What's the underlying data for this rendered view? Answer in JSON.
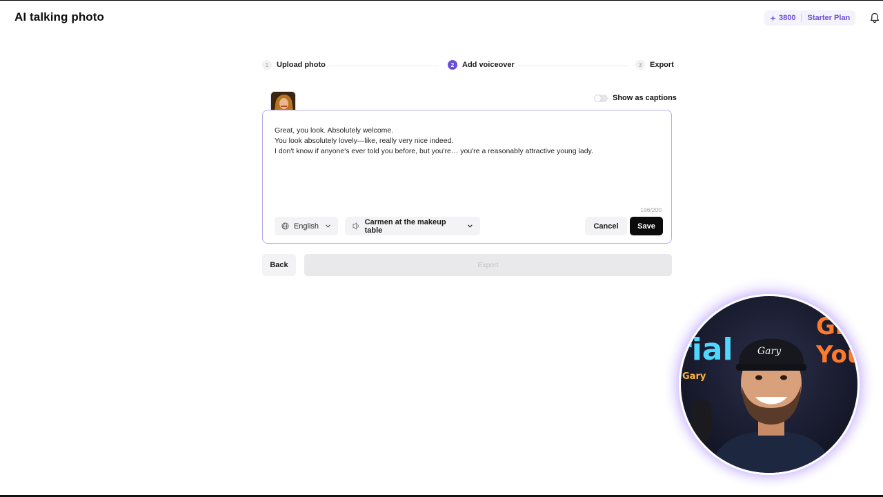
{
  "header": {
    "title": "AI talking photo",
    "credits": "3800",
    "plan": "Starter Plan"
  },
  "stepper": {
    "steps": [
      {
        "number": "1",
        "label": "Upload photo",
        "state": "done"
      },
      {
        "number": "2",
        "label": "Add voiceover",
        "state": "active"
      },
      {
        "number": "3",
        "label": "Export",
        "state": "pending"
      }
    ]
  },
  "captions": {
    "label": "Show as captions",
    "enabled": false
  },
  "editor": {
    "lines": [
      "Great, you look. Absolutely welcome.",
      "You look absolutely lovely—like, really very nice indeed.",
      "I don't know if anyone's ever told you before, but you're… you're a reasonably attractive young lady."
    ],
    "char_count": "196/200",
    "language": "English",
    "voice": "Carmen at the makeup table",
    "cancel_label": "Cancel",
    "save_label": "Save"
  },
  "footer": {
    "back_label": "Back",
    "export_label": "Export"
  },
  "webcam": {
    "cap_text": "Gary",
    "neon_left": "rial",
    "neon_small": "Gary",
    "neon_right_top": "Gr",
    "neon_right_bottom": "You"
  },
  "colors": {
    "accent": "#6b4fd8",
    "editor_border": "#b9a8ec",
    "save_bg": "#0b0b0b"
  },
  "icons": {
    "credits": "sparkle-icon",
    "notifications": "bell-icon",
    "language": "globe-icon",
    "voice": "voice-icon",
    "dropdown": "chevron-down-icon"
  }
}
